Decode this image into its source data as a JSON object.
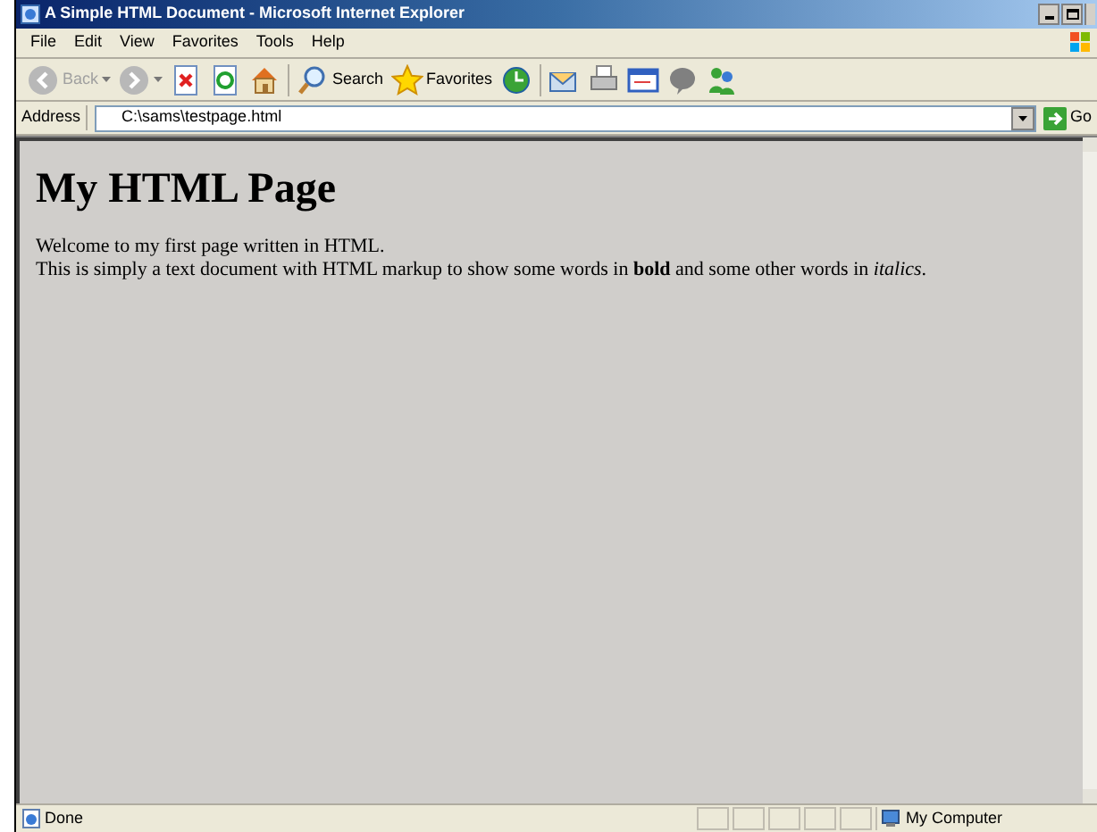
{
  "window": {
    "title": "A Simple HTML Document - Microsoft Internet Explorer"
  },
  "menu": [
    "File",
    "Edit",
    "View",
    "Favorites",
    "Tools",
    "Help"
  ],
  "toolbar": [
    {
      "kind": "back",
      "label": "Back",
      "disabled": true
    },
    {
      "kind": "forward",
      "disabled": true
    },
    {
      "kind": "stop"
    },
    {
      "kind": "refresh"
    },
    {
      "kind": "home"
    },
    {
      "kind": "sep"
    },
    {
      "kind": "search",
      "label": "Search"
    },
    {
      "kind": "favorites",
      "label": "Favorites"
    },
    {
      "kind": "history"
    },
    {
      "kind": "sep"
    },
    {
      "kind": "mail"
    },
    {
      "kind": "print"
    },
    {
      "kind": "edit"
    },
    {
      "kind": "discuss"
    },
    {
      "kind": "messenger"
    }
  ],
  "address": {
    "label": "Address",
    "value": "C:\\sams\\testpage.html",
    "go": "Go"
  },
  "page": {
    "heading": "My HTML Page",
    "lines": [
      "Welcome to my first page written in HTML.",
      "This is simply a text document with HTML markup to show some words in **bold** and some other words in *italics*."
    ]
  },
  "status_bar": {
    "text": "Done",
    "zone": "My Computer"
  }
}
